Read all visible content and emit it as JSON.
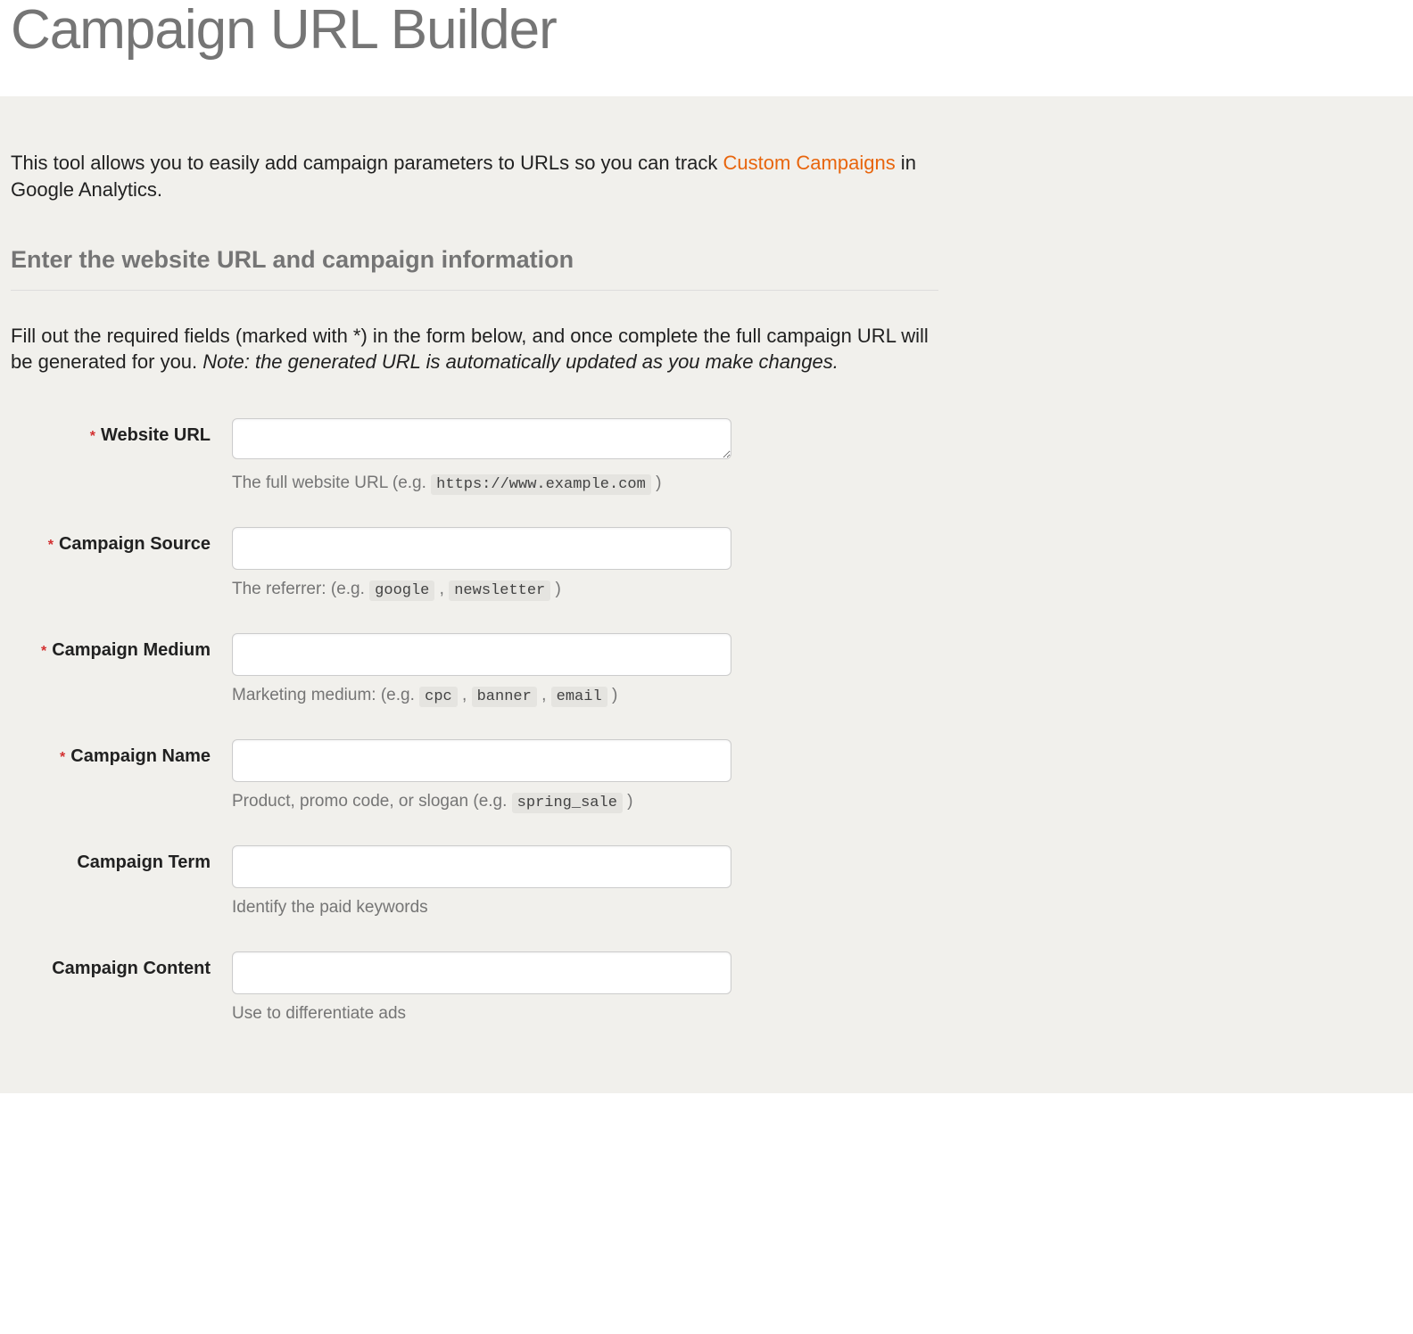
{
  "page_title": "Campaign URL Builder",
  "intro": {
    "before_link": "This tool allows you to easily add campaign parameters to URLs so you can track ",
    "link_text": "Custom Campaigns",
    "after_link": " in Google Analytics."
  },
  "section_heading": "Enter the website URL and campaign information",
  "instructions": {
    "text": "Fill out the required fields (marked with *) in the form below, and once complete the full campaign URL will be generated for you. ",
    "note": "Note: the generated URL is automatically updated as you make changes."
  },
  "fields": {
    "website_url": {
      "label": "Website URL",
      "required": true,
      "value": "",
      "help_before": "The full website URL (e.g. ",
      "help_codes": [
        "https://www.example.com"
      ],
      "help_after": " )"
    },
    "campaign_source": {
      "label": "Campaign Source",
      "required": true,
      "value": "",
      "help_before": "The referrer: (e.g. ",
      "help_codes": [
        "google",
        "newsletter"
      ],
      "help_after": " )"
    },
    "campaign_medium": {
      "label": "Campaign Medium",
      "required": true,
      "value": "",
      "help_before": "Marketing medium: (e.g. ",
      "help_codes": [
        "cpc",
        "banner",
        "email"
      ],
      "help_after": " )"
    },
    "campaign_name": {
      "label": "Campaign Name",
      "required": true,
      "value": "",
      "help_before": "Product, promo code, or slogan (e.g. ",
      "help_codes": [
        "spring_sale"
      ],
      "help_after": " )"
    },
    "campaign_term": {
      "label": "Campaign Term",
      "required": false,
      "value": "",
      "help_plain": "Identify the paid keywords"
    },
    "campaign_content": {
      "label": "Campaign Content",
      "required": false,
      "value": "",
      "help_plain": "Use to differentiate ads"
    }
  },
  "asterisk": "*"
}
